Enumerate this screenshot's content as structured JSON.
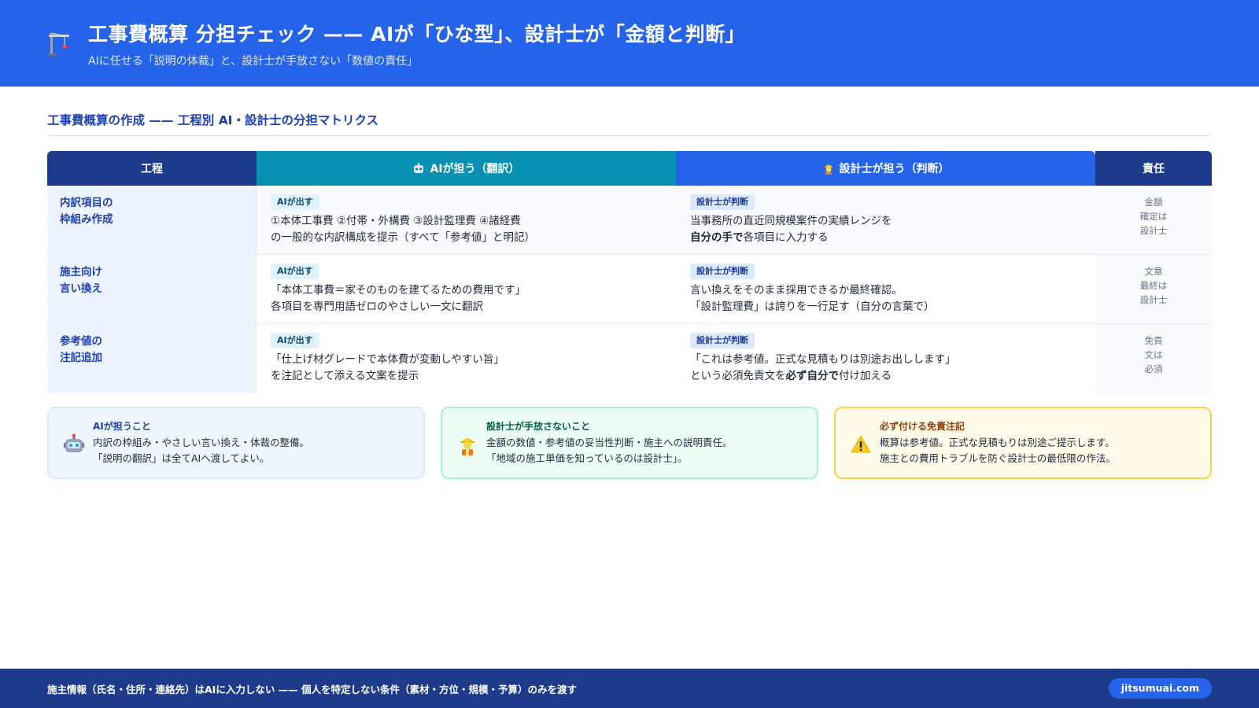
{
  "header": {
    "title": "工事費概算 分担チェック —— AIが「ひな型」、設計士が「金額と判断」",
    "subtitle": "AIに任せる「説明の体裁」と、設計士が手放さない「数値の責任」",
    "icon": "crane-icon"
  },
  "section": {
    "title": "工事費概算の作成 —— 工程別 AI・設計士の分担マトリクス"
  },
  "table": {
    "headers": {
      "step": "工程",
      "ai": "AIが担う（翻訳）",
      "architect": "設計士が担う（判断）",
      "responsibility": "責任"
    },
    "rows": [
      {
        "step_line1": "内訳項目の",
        "step_line2": "枠組み作成",
        "ai_tag": "AIが出す",
        "ai_line1": "①本体工事費 ②付帯・外構費 ③設計監理費 ④諸経費",
        "ai_line2": "の一般的な内訳構成を提示（すべて「参考値」と明記）",
        "arch_tag": "設計士が判断",
        "arch_line1": "当事務所の直近同規模案件の実績レンジを",
        "arch_line2_bold": "自分の手で",
        "arch_line2_rest": "各項目に入力する",
        "resp_1": "金額",
        "resp_2": "確定は",
        "resp_3": "設計士"
      },
      {
        "step_line1": "施主向け",
        "step_line2": "言い換え",
        "ai_tag": "AIが出す",
        "ai_line1": "「本体工事費＝家そのものを建てるための費用です」",
        "ai_line2": "各項目を専門用語ゼロのやさしい一文に翻訳",
        "arch_tag": "設計士が判断",
        "arch_line1": "言い換えをそのまま採用できるか最終確認。",
        "arch_line2": "「設計監理費」は誇りを一行足す（自分の言葉で）",
        "resp_1": "文章",
        "resp_2": "最終は",
        "resp_3": "設計士"
      },
      {
        "step_line1": "参考値の",
        "step_line2": "注記追加",
        "ai_tag": "AIが出す",
        "ai_line1": "「仕上げ材グレードで本体費が変動しやすい旨」",
        "ai_line2": "を注記として添える文案を提示",
        "arch_tag": "設計士が判断",
        "arch_line1": "「これは参考値。正式な見積もりは別途お出しします」",
        "arch_line2_pre": "という必須免責文を",
        "arch_line2_bold": "必ず自分で",
        "arch_line2_rest": "付け加える",
        "resp_1": "免責",
        "resp_2": "文は",
        "resp_3": "必須"
      }
    ]
  },
  "cards": {
    "ai": {
      "icon": "robot-icon",
      "title": "AIが担うこと",
      "line1": "内訳の枠組み・やさしい言い換え・体裁の整備。",
      "line2": "「説明の翻訳」は全てAIへ渡してよい。"
    },
    "architect": {
      "icon": "worker-icon",
      "title": "設計士が手放さないこと",
      "line1": "金額の数値・参考値の妥当性判断・施主への説明責任。",
      "line2": "「地域の施工単価を知っているのは設計士」。"
    },
    "warning": {
      "icon": "warning-icon",
      "title": "必ず付ける免責注記",
      "line1": "概算は参考値。正式な見積もりは別途ご提示します。",
      "line2": "施主との費用トラブルを防ぐ設計士の最低限の作法。"
    }
  },
  "footer": {
    "text": "施主情報（氏名・住所・連絡先）はAIに入力しない —— 個人を特定しない条件（素材・方位・規模・予算）のみを渡す",
    "badge": "jitsumuai.com"
  },
  "colors": {
    "primary": "#2563eb",
    "navy": "#1e3a8a",
    "teal": "#0891b2"
  }
}
